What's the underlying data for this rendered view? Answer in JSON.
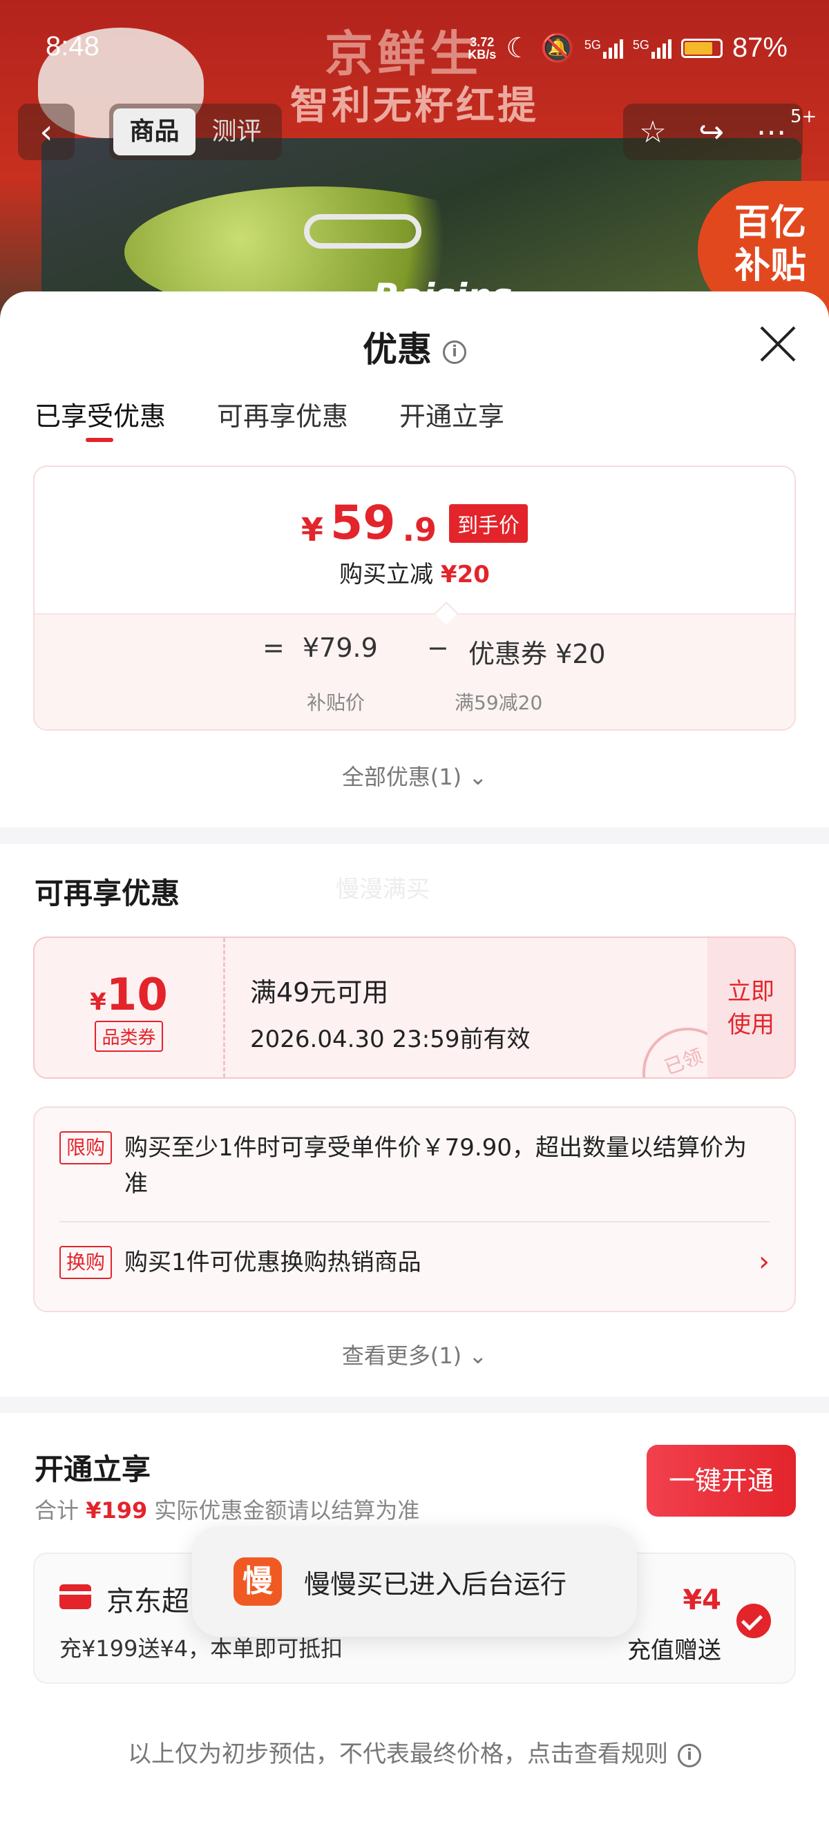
{
  "status_bar": {
    "time": "8:48",
    "net_speed_value": "3.72",
    "net_speed_unit": "KB/s",
    "signal1": "5G",
    "signal2": "5G",
    "battery": "87%"
  },
  "background": {
    "brand_name": "京鲜生",
    "product_name": "智利无籽红提",
    "badge": "5+",
    "subsidy_logo_line1": "百亿",
    "subsidy_logo_line2": "补贴",
    "box_text": "Raisins"
  },
  "nav": {
    "tab_product": "商品",
    "tab_review": "测评"
  },
  "sheet": {
    "title": "优惠",
    "tabs": [
      "已享受优惠",
      "可再享优惠",
      "开通立享"
    ]
  },
  "price_card": {
    "currency": "¥",
    "price_int": "59",
    "price_dec": ".9",
    "price_tag": "到手价",
    "reduce_text": "购买立减",
    "reduce_amount": "¥20",
    "eq_sign": "=",
    "subsidy_price": "¥79.9",
    "minus_sign": "−",
    "coupon_text": "优惠券 ¥20",
    "subsidy_label": "补贴价",
    "coupon_label": "满59减20"
  },
  "all_offers": "全部优惠(1)",
  "more_section": {
    "title": "可再享优惠",
    "watermark": "慢漫满买",
    "coupon": {
      "currency": "¥",
      "amount": "10",
      "category": "品类券",
      "condition": "满49元可用",
      "expiry": "2026.04.30 23:59前有效",
      "use_label_1": "立即",
      "use_label_2": "使用",
      "stamp": "已领"
    },
    "promos": [
      {
        "tag": "限购",
        "text": "购买至少1件时可享受单件价￥79.90，超出数量以结算价为准"
      },
      {
        "tag": "换购",
        "text": "购买1件可优惠换购热销商品"
      }
    ],
    "see_more": "查看更多(1)"
  },
  "open_section": {
    "title": "开通立享",
    "button": "一键开通",
    "summary_prefix": "合计",
    "summary_amount": "¥199",
    "summary_suffix": "实际优惠金额请以结算为准",
    "member": {
      "name": "京东超",
      "desc": "充¥199送¥4，本单即可抵扣",
      "amount": "¥4",
      "gift": "充值赠送"
    }
  },
  "toast": {
    "icon_char": "慢",
    "text": "慢慢买已进入后台运行"
  },
  "footer": "以上仅为初步预估，不代表最终价格，点击查看规则",
  "colors": {
    "accent": "#e3242b",
    "accent_light": "#fdf1f2"
  }
}
